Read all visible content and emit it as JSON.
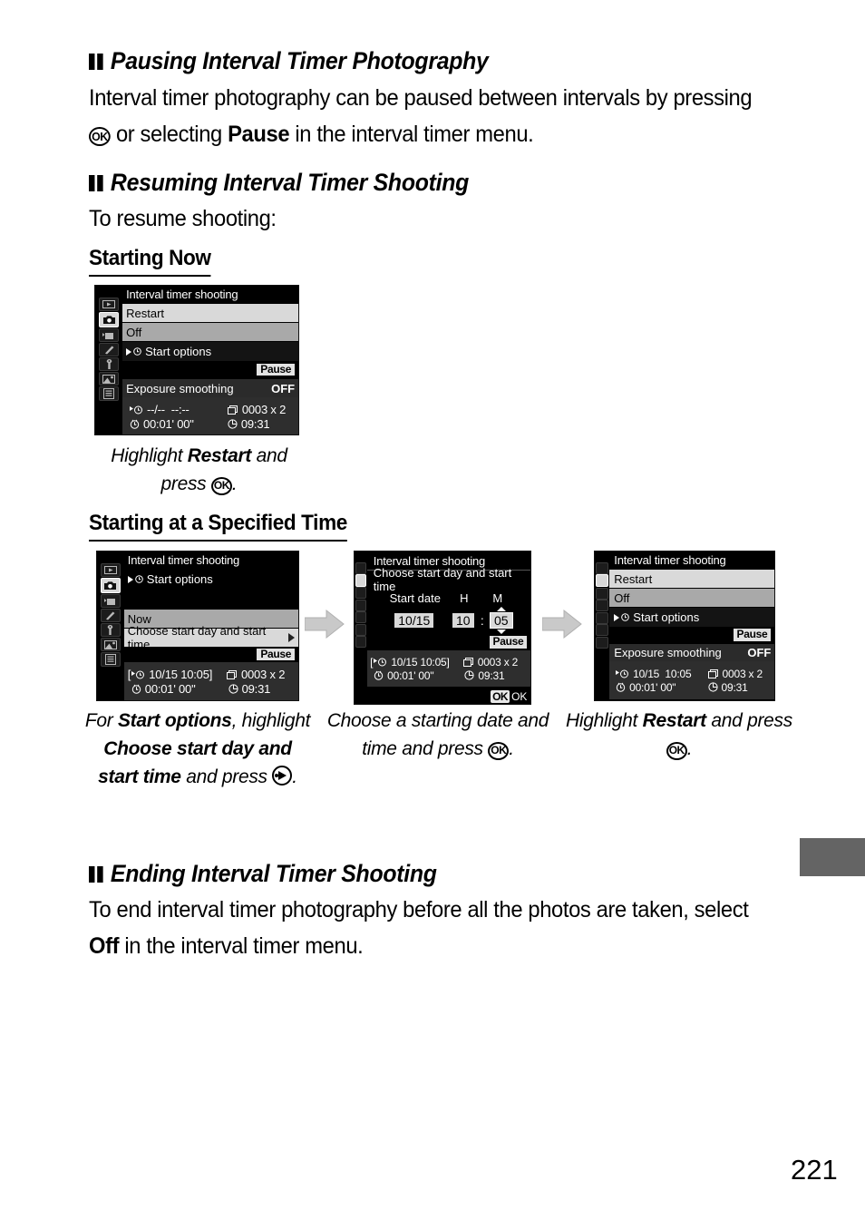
{
  "page": {
    "number": "221"
  },
  "sections": [
    {
      "id": "pausing",
      "heading": "Pausing Interval Timer Photography",
      "paragraph_pre": "Interval timer photography can be paused between intervals by pressing ",
      "paragraph_mid": " or selecting ",
      "paragraph_bold": "Pause",
      "paragraph_post": " in the interval timer menu.",
      "ok_label": "OK"
    },
    {
      "id": "resuming",
      "heading": "Resuming Interval Timer Shooting",
      "paragraph": "To resume shooting:"
    },
    {
      "id": "ending",
      "heading": "Ending Interval Timer Shooting",
      "paragraph_pre": "To end interval timer photography before all the photos are taken, select ",
      "paragraph_bold": "Off",
      "paragraph_post": " in the interval timer menu."
    }
  ],
  "subheadings": {
    "starting_now": "Starting Now",
    "starting_specified": "Starting at a Specified Time"
  },
  "captions": {
    "now": {
      "pre": "Highlight ",
      "bold": "Restart",
      "mid": " and press ",
      "ok": "OK",
      "post": "."
    },
    "step1": {
      "pre": "For ",
      "bold1": "Start options",
      "mid1": ", highlight ",
      "bold2": "Choose start day and start time",
      "mid2": " and press ",
      "post": "."
    },
    "step2": {
      "pre": "Choose a starting date and time and press ",
      "ok": "OK",
      "post": "."
    },
    "step3": {
      "pre": "Highlight ",
      "bold": "Restart",
      "mid": " and press ",
      "ok": "OK",
      "post": "."
    }
  },
  "lcd_common": {
    "title": "Interval timer shooting",
    "pause_badge": "Pause",
    "sidebar_icons": [
      "playback-icon",
      "shooting-menu-icon",
      "movie-menu-icon",
      "custom-settings-icon",
      "setup-menu-icon",
      "retouch-menu-icon",
      "recent-settings-icon"
    ]
  },
  "screen_now": {
    "title": "Interval timer shooting",
    "rows": [
      {
        "label": "Restart",
        "state": "highlighted"
      },
      {
        "label": "Off",
        "state": "selected"
      },
      {
        "label": "Start options",
        "state": "normal",
        "has_arrow_icon": true
      }
    ],
    "pause_badge": "Pause",
    "exposure_smoothing_label": "Exposure smoothing",
    "exposure_smoothing_value": "OFF",
    "info": {
      "start_date": "--/--",
      "start_time": "--:--",
      "shots": "0003 x 2",
      "interval": "00:01' 00\"",
      "end_time": "09:31"
    }
  },
  "screen_start_options": {
    "title": "Interval timer shooting",
    "submenu_label": "Start options",
    "rows": [
      {
        "label": "Now",
        "state": "normal"
      },
      {
        "label": "Choose start day and start time",
        "state": "highlighted",
        "has_chevron": true
      }
    ],
    "pause_badge": "Pause",
    "info": {
      "bracket_open": "[",
      "start_date": "10/15",
      "start_time": "10:05",
      "bracket_close": "]",
      "shots": "0003 x 2",
      "interval": "00:01' 00\"",
      "end_time": "09:31"
    }
  },
  "screen_date_entry": {
    "title": "Interval timer shooting",
    "subtitle": "Choose start day and start time",
    "field_labels": {
      "date": "Start date",
      "hour": "H",
      "minute": "M"
    },
    "field_values": {
      "date": "10/15",
      "hour": "10",
      "separator": ":",
      "minute": "05"
    },
    "pause_badge": "Pause",
    "ok_hint_badge": "OK",
    "ok_hint_text": "OK",
    "info": {
      "bracket_open": "[",
      "start_date": "10/15",
      "start_time": "10:05",
      "bracket_close": "]",
      "shots": "0003 x 2",
      "interval": "00:01' 00\"",
      "end_time": "09:31"
    }
  },
  "screen_restart": {
    "title": "Interval timer shooting",
    "rows": [
      {
        "label": "Restart",
        "state": "highlighted"
      },
      {
        "label": "Off",
        "state": "selected"
      },
      {
        "label": "Start options",
        "state": "normal",
        "has_arrow_icon": true
      }
    ],
    "pause_badge": "Pause",
    "exposure_smoothing_label": "Exposure smoothing",
    "exposure_smoothing_value": "OFF",
    "info": {
      "start_date": "10/15",
      "start_time": "10:05",
      "shots": "0003 x 2",
      "interval": "00:01' 00\"",
      "end_time": "09:31"
    }
  },
  "colors": {
    "margin_tab": "#646464",
    "lcd_background": "#000000",
    "highlight_row": "#d9d9d9",
    "selected_row": "#a9a9a9",
    "info_box": "#2e2e2e",
    "flow_arrow": "#bfbfbf"
  }
}
